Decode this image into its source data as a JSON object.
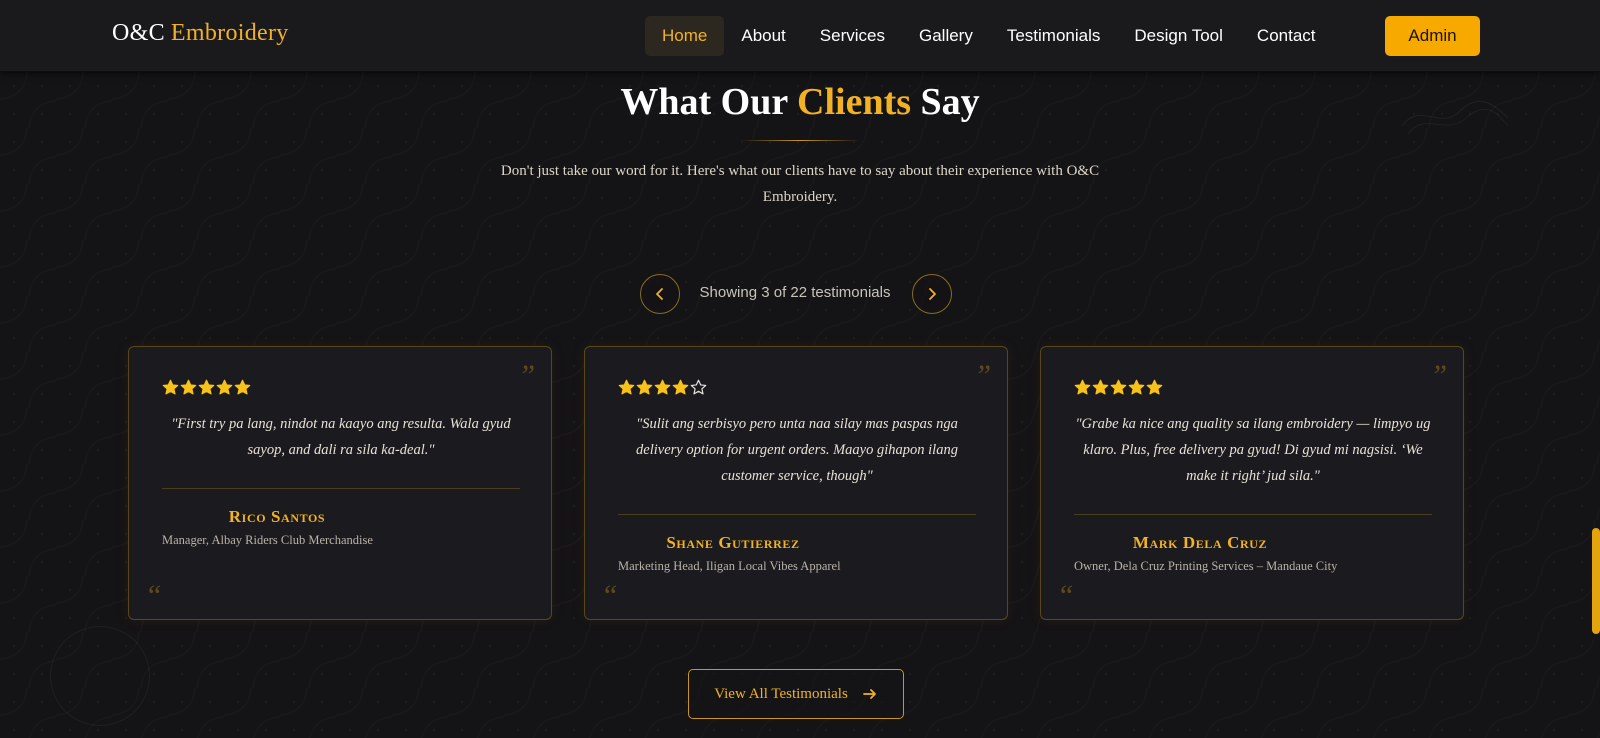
{
  "brand": {
    "name": "O&C",
    "accent": "Embroidery"
  },
  "nav": {
    "items": [
      {
        "label": "Home",
        "active": true
      },
      {
        "label": "About",
        "active": false
      },
      {
        "label": "Services",
        "active": false
      },
      {
        "label": "Gallery",
        "active": false
      },
      {
        "label": "Testimonials",
        "active": false
      },
      {
        "label": "Design Tool",
        "active": false
      },
      {
        "label": "Contact",
        "active": false
      }
    ],
    "admin_label": "Admin"
  },
  "section": {
    "title_pre": "What Our",
    "title_accent": "Clients",
    "title_post": "Say",
    "subtitle": "Don't just take our word for it. Here's what our clients have to say about their experience with O&C Embroidery."
  },
  "pager": {
    "status": "Showing 3 of 22 testimonials",
    "prev_icon": "chevron-left-icon",
    "next_icon": "chevron-right-icon"
  },
  "testimonials": [
    {
      "rating": 5,
      "quote": "\"First try pa lang, nindot na kaayo ang resulta. Wala gyud sayop, and dali ra sila ka-deal.\"",
      "name": "Rico Santos",
      "role": "Manager, Albay Riders Club Merchandise"
    },
    {
      "rating": 4,
      "quote": "\"Sulit ang serbisyo pero unta naa silay mas paspas nga delivery option for urgent orders. Maayo gihapon ilang customer service, though\"",
      "name": "Shane Gutierrez",
      "role": "Marketing Head, Iligan Local Vibes Apparel"
    },
    {
      "rating": 5,
      "quote": "\"Grabe ka nice ang quality sa ilang embroidery — limpyo ug klaro. Plus, free delivery pa gyud! Di gyud mi nagsisi. ‘We make it right’ jud sila.\"",
      "name": "Mark Dela Cruz",
      "role": "Owner, Dela Cruz Printing Services – Mandaue City"
    }
  ],
  "quote_mark": "”",
  "quote_mark_open": "“",
  "cta": {
    "label": "View All Testimonials",
    "icon": "arrow-right-icon"
  },
  "colors": {
    "accent": "#f2b224",
    "admin_bg": "#f7a900",
    "background": "#141316",
    "card_bg": "#1b1a1e",
    "card_border": "#5a4719"
  }
}
